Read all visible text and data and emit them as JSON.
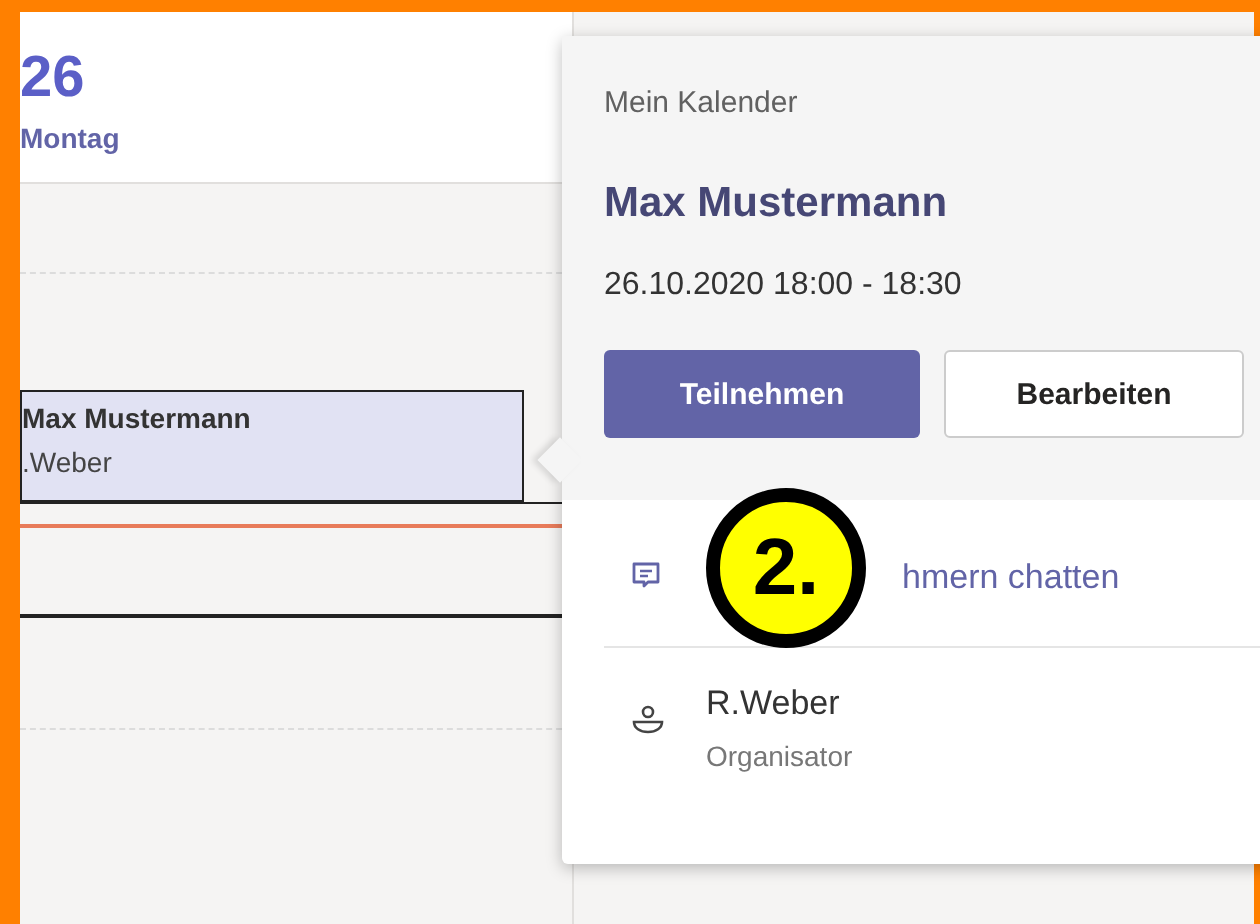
{
  "day": {
    "number": "26",
    "name": "Montag"
  },
  "event": {
    "title": "Max Mustermann",
    "organizer": ".Weber"
  },
  "popup": {
    "calendar": "Mein Kalender",
    "title": "Max Mustermann",
    "time": "26.10.2020 18:00 - 18:30",
    "buttons": [
      {
        "label": "Teilnehmen",
        "kind": "primary"
      },
      {
        "label": "Bearbeiten",
        "kind": "secondary"
      }
    ],
    "chat": {
      "label": "hmern chatten"
    },
    "organizer": {
      "name": "R.Weber",
      "role": "Organisator"
    }
  },
  "callout": {
    "label": "2."
  }
}
